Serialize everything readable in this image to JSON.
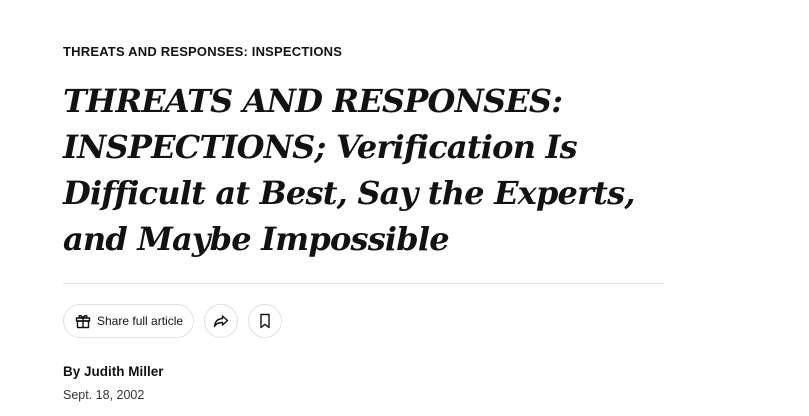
{
  "article": {
    "kicker": "THREATS AND RESPONSES: INSPECTIONS",
    "headline": "THREATS AND RESPONSES: INSPECTIONS; Verification Is Difficult at Best, Say the Experts, and Maybe Impossible",
    "byline": "By Judith Miller",
    "date": "Sept. 18, 2002"
  },
  "actions": {
    "share_full_label": "Share full article",
    "share_icon": "gift-icon",
    "forward_icon": "share-arrow-icon",
    "save_icon": "bookmark-icon"
  }
}
